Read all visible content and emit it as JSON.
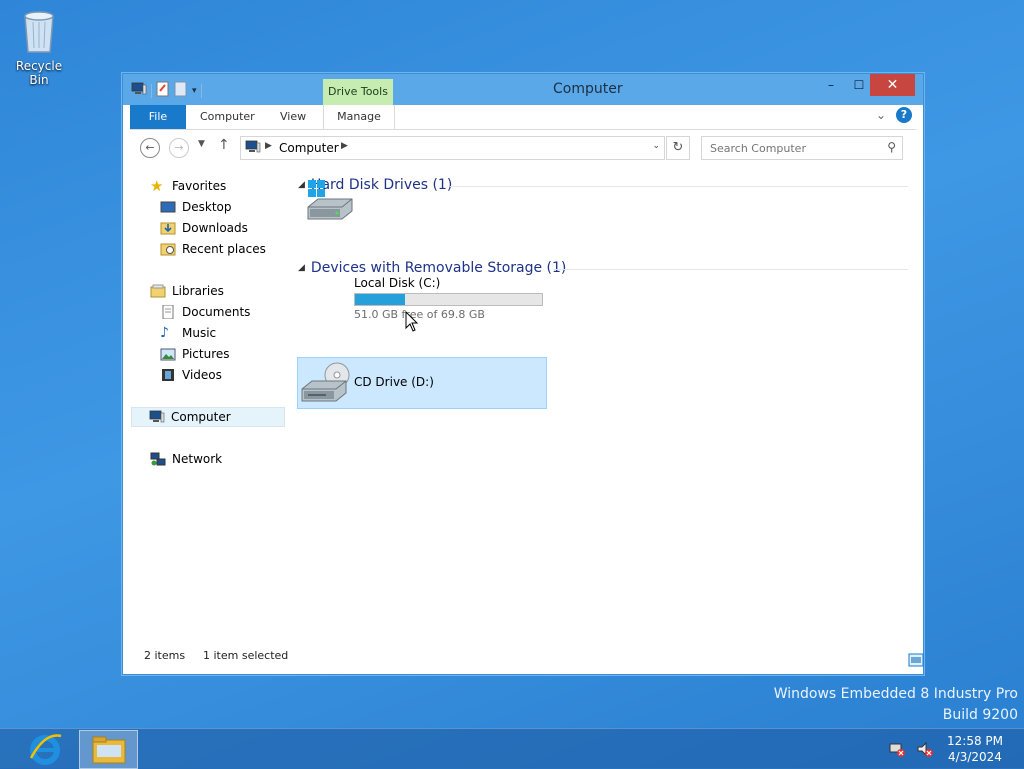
{
  "desktop": {
    "recycle_bin_label": "Recycle Bin",
    "watermark_line1": "Windows Embedded 8 Industry Pro",
    "watermark_line2": "Build 9200"
  },
  "window": {
    "title": "Computer",
    "contextual_tab_group": "Drive Tools",
    "controls": {
      "minimize": "–",
      "maximize": "☐",
      "close": "✕"
    }
  },
  "ribbon": {
    "tabs": [
      {
        "label": "File"
      },
      {
        "label": "Computer"
      },
      {
        "label": "View"
      },
      {
        "label": "Manage"
      }
    ],
    "help": "?"
  },
  "navigation": {
    "address_crumb": "Computer",
    "search_placeholder": "Search Computer"
  },
  "nav_pane": {
    "favorites": "Favorites",
    "desktop": "Desktop",
    "downloads": "Downloads",
    "recent_places": "Recent places",
    "libraries": "Libraries",
    "documents": "Documents",
    "music": "Music",
    "pictures": "Pictures",
    "videos": "Videos",
    "computer": "Computer",
    "network": "Network"
  },
  "content": {
    "groups": [
      {
        "header": "Hard Disk Drives (1)",
        "items": [
          {
            "name": "Local Disk (C:)",
            "free_text": "51.0 GB free of 69.8 GB",
            "used_fraction": 0.27
          }
        ]
      },
      {
        "header": "Devices with Removable Storage (1)",
        "items": [
          {
            "name": "CD Drive (D:)"
          }
        ]
      }
    ]
  },
  "status": {
    "items_count": "2 items",
    "selected": "1 item selected"
  },
  "taskbar": {
    "time": "12:58 PM",
    "date": "4/3/2024"
  },
  "colors": {
    "accent": "#1979ca",
    "drive_bar": "#26a0da",
    "selection": "#cce8ff",
    "close_button": "#c7463f",
    "contextual_tab": "#c7ecb2"
  }
}
